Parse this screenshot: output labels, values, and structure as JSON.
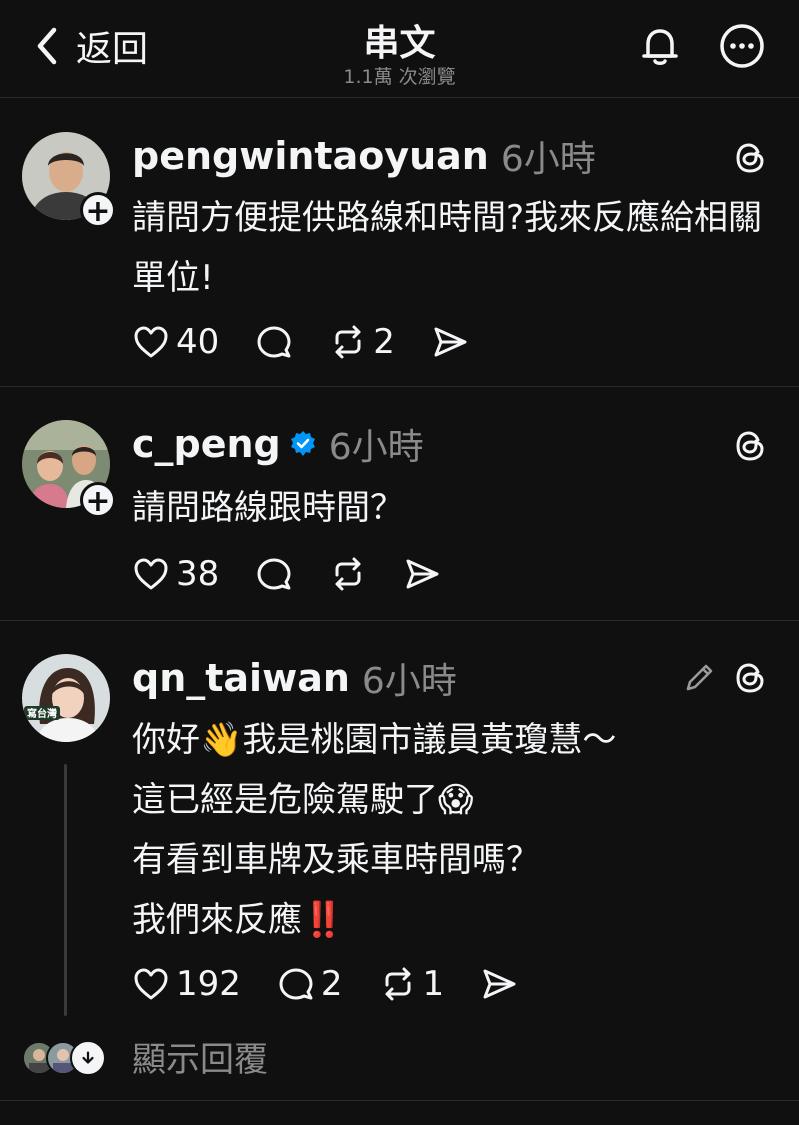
{
  "header": {
    "back_label": "返回",
    "title": "串文",
    "subtitle": "1.1萬 次瀏覽"
  },
  "posts": [
    {
      "username": "pengwintaoyuan",
      "time": "6小時",
      "verified": false,
      "text": "請問方便提供路線和時間?我來反應給相關單位!",
      "likes": "40",
      "replies": "",
      "reposts": "2"
    },
    {
      "username": "c_peng",
      "time": "6小時",
      "verified": true,
      "text": "請問路線跟時間？",
      "likes": "38",
      "replies": "",
      "reposts": ""
    },
    {
      "username": "qn_taiwan",
      "time": "6小時",
      "verified": false,
      "avatar_text": "寫台灣",
      "text": "你好👋我是桃園市議員黃瓊慧～\n這已經是危險駕駛了😱\n有看到車牌及乘車時間嗎？\n我們來反應‼️",
      "likes": "192",
      "replies": "2",
      "reposts": "1"
    }
  ],
  "footer": {
    "show_replies_label": "顯示回覆"
  },
  "colors": {
    "background": "#101010",
    "text": "#f3f5f7",
    "muted": "#8a8a8a",
    "verified": "#0095f6"
  }
}
